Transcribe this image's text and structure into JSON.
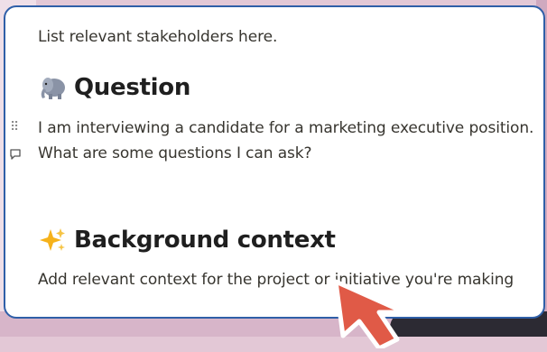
{
  "stakeholders_text": "List relevant stakeholders here.",
  "question": {
    "heading": "Question",
    "emoji": "elephant-emoji",
    "lines": [
      "I am interviewing a candidate for a marketing executive position.",
      "What are some questions I can ask?"
    ]
  },
  "background": {
    "heading": "Background context",
    "emoji": "sparkles-emoji",
    "text": "Add relevant context for the project or initiative you're making"
  },
  "colors": {
    "card_border": "#2f5fa8",
    "cursor_fill": "#e05a47",
    "text": "#37352f"
  }
}
